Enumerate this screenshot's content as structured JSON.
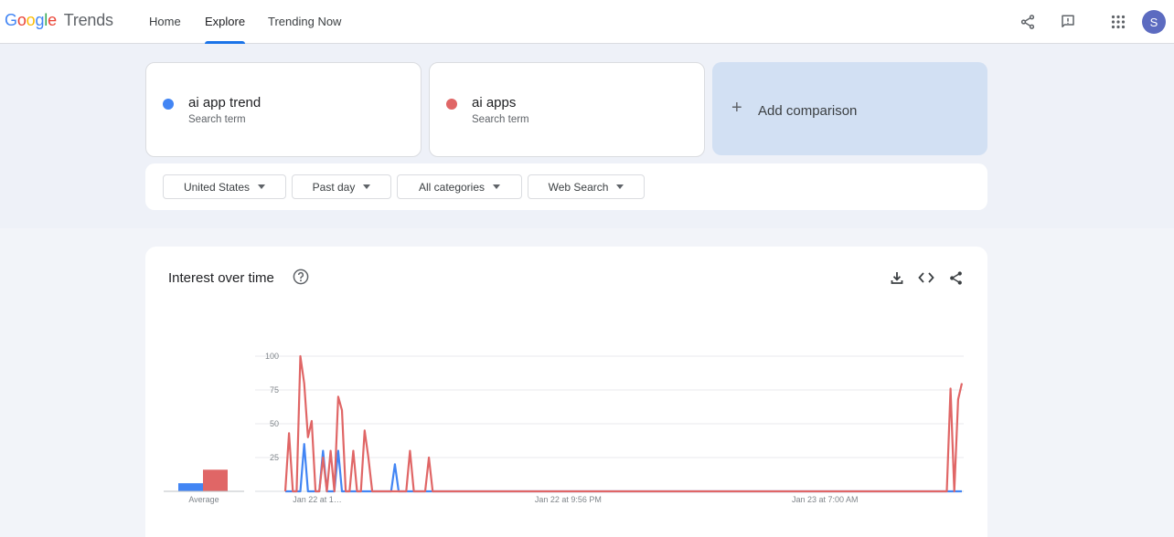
{
  "app": {
    "logo_google": "Google",
    "logo_trends": "Trends",
    "nav": [
      {
        "label": "Home",
        "active": false
      },
      {
        "label": "Explore",
        "active": true
      },
      {
        "label": "Trending Now",
        "active": false
      }
    ],
    "header_icons": [
      "share-icon",
      "feedback-icon",
      "apps-grid-icon"
    ],
    "avatar_letter": "S"
  },
  "terms": [
    {
      "name": "ai app trend",
      "subtitle": "Search term",
      "color": "#4285f4"
    },
    {
      "name": "ai apps",
      "subtitle": "Search term",
      "color": "#e06666"
    }
  ],
  "add_comparison": {
    "label": "Add comparison",
    "icon": "plus-icon"
  },
  "filters": [
    {
      "label": "United States"
    },
    {
      "label": "Past day"
    },
    {
      "label": "All categories"
    },
    {
      "label": "Web Search"
    }
  ],
  "interest_over_time": {
    "title": "Interest over time",
    "icons": [
      "help-icon",
      "download-icon",
      "embed-icon",
      "share-icon"
    ],
    "average_label": "Average"
  },
  "chart_data": {
    "type": "line",
    "title": "Interest over time",
    "xlabel": "",
    "ylabel": "",
    "ylim": [
      0,
      100
    ],
    "yticks": [
      25,
      50,
      75,
      100
    ],
    "x_tick_labels": [
      {
        "index": 2,
        "label": "Jan 22 at 1…"
      },
      {
        "index": 66,
        "label": "Jan 22 at 9:56 PM"
      },
      {
        "index": 134,
        "label": "Jan 23 at 7:00 AM"
      }
    ],
    "grid": true,
    "n_points": 180,
    "series": [
      {
        "color": "#4285f4",
        "values": [
          0,
          0,
          0,
          0,
          0,
          35,
          0,
          0,
          0,
          0,
          30,
          0,
          0,
          0,
          30,
          0,
          0,
          0,
          0,
          0,
          0,
          0,
          0,
          0,
          0,
          0,
          0,
          0,
          0,
          20,
          0,
          0,
          0,
          0,
          0,
          0,
          0,
          0,
          0,
          0,
          0,
          0,
          0,
          0,
          0,
          0,
          0,
          0,
          0,
          0,
          0,
          0,
          0,
          0,
          0,
          0,
          0,
          0,
          0,
          0,
          0,
          0,
          0,
          0,
          0,
          0,
          0,
          0,
          0,
          0,
          0,
          0,
          0,
          0,
          0,
          0,
          0,
          0,
          0,
          0,
          0,
          0,
          0,
          0,
          0,
          0,
          0,
          0,
          0,
          0,
          0,
          0,
          0,
          0,
          0,
          0,
          0,
          0,
          0,
          0,
          0,
          0,
          0,
          0,
          0,
          0,
          0,
          0,
          0,
          0,
          0,
          0,
          0,
          0,
          0,
          0,
          0,
          0,
          0,
          0,
          0,
          0,
          0,
          0,
          0,
          0,
          0,
          0,
          0,
          0,
          0,
          0,
          0,
          0,
          0,
          0,
          0,
          0,
          0,
          0,
          0,
          0,
          0,
          0,
          0,
          0,
          0,
          0,
          0,
          0,
          0,
          0,
          0,
          0,
          0,
          0,
          0,
          0,
          0,
          0,
          0,
          0,
          0,
          0,
          0,
          0,
          0,
          0,
          0,
          0,
          0,
          0,
          0,
          0,
          0,
          0,
          0,
          0,
          0,
          0
        ]
      },
      {
        "color": "#e06666",
        "values": [
          0,
          43,
          0,
          0,
          100,
          80,
          40,
          52,
          0,
          0,
          25,
          0,
          30,
          0,
          70,
          60,
          0,
          0,
          30,
          0,
          0,
          45,
          25,
          0,
          0,
          0,
          0,
          0,
          0,
          0,
          0,
          0,
          0,
          30,
          0,
          0,
          0,
          0,
          25,
          0,
          0,
          0,
          0,
          0,
          0,
          0,
          0,
          0,
          0,
          0,
          0,
          0,
          0,
          0,
          0,
          0,
          0,
          0,
          0,
          0,
          0,
          0,
          0,
          0,
          0,
          0,
          0,
          0,
          0,
          0,
          0,
          0,
          0,
          0,
          0,
          0,
          0,
          0,
          0,
          0,
          0,
          0,
          0,
          0,
          0,
          0,
          0,
          0,
          0,
          0,
          0,
          0,
          0,
          0,
          0,
          0,
          0,
          0,
          0,
          0,
          0,
          0,
          0,
          0,
          0,
          0,
          0,
          0,
          0,
          0,
          0,
          0,
          0,
          0,
          0,
          0,
          0,
          0,
          0,
          0,
          0,
          0,
          0,
          0,
          0,
          0,
          0,
          0,
          0,
          0,
          0,
          0,
          0,
          0,
          0,
          0,
          0,
          0,
          0,
          0,
          0,
          0,
          0,
          0,
          0,
          0,
          0,
          0,
          0,
          0,
          0,
          0,
          0,
          0,
          0,
          0,
          0,
          0,
          0,
          0,
          0,
          0,
          0,
          0,
          0,
          0,
          0,
          0,
          0,
          0,
          0,
          0,
          0,
          0,
          0,
          0,
          76,
          0,
          68,
          80
        ]
      }
    ],
    "averages": [
      {
        "color": "#4285f4",
        "value": 6
      },
      {
        "color": "#e06666",
        "value": 16
      }
    ]
  }
}
